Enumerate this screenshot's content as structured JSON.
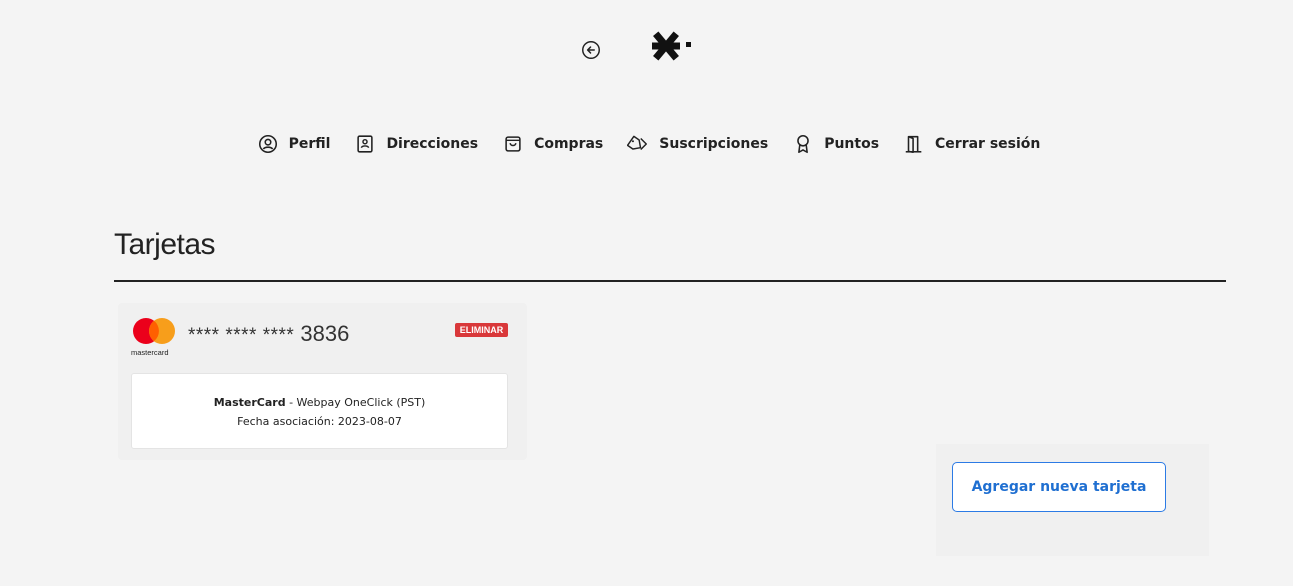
{
  "header": {
    "back_icon": "arrow-left-circle-icon",
    "logo_icon": "asterisk-dot-logo"
  },
  "nav": {
    "items": [
      {
        "label": "Perfil",
        "icon": "user-circle-icon"
      },
      {
        "label": "Direcciones",
        "icon": "address-book-icon"
      },
      {
        "label": "Compras",
        "icon": "shopping-bag-icon"
      },
      {
        "label": "Suscripciones",
        "icon": "tags-icon"
      },
      {
        "label": "Puntos",
        "icon": "award-ribbon-icon"
      },
      {
        "label": "Cerrar sesión",
        "icon": "door-exit-icon"
      }
    ]
  },
  "page": {
    "title": "Tarjetas"
  },
  "card": {
    "brand_logo_text": "mastercard",
    "masked_digits": "**** **** ****",
    "last_digits": "3836",
    "delete_label": "ELIMINAR",
    "brand": "MasterCard",
    "provider": " - Webpay OneClick (PST)",
    "association_date": "Fecha asociación: 2023-08-07"
  },
  "actions": {
    "add_card_label": "Agregar nueva tarjeta"
  },
  "colors": {
    "background": "#f4f4f4",
    "delete_red": "#d9383a",
    "accent_blue": "#1f6fd1",
    "mastercard_red": "#eb001b",
    "mastercard_orange": "#f79e1b"
  }
}
